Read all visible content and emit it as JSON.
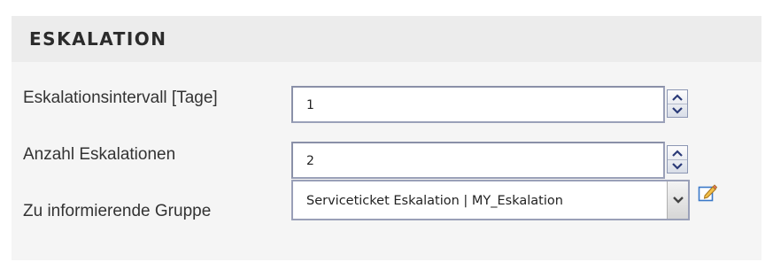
{
  "section": {
    "title": "ESKALATION"
  },
  "fields": [
    {
      "label": "Eskalationsintervall [Tage]",
      "value": "1"
    },
    {
      "label": "Anzahl Eskalationen",
      "value": "2"
    }
  ],
  "group_select": {
    "label": "Zu informierende Gruppe",
    "selected": "Serviceticket Eskalation | MY_Eskalation"
  },
  "icons": {
    "spinner_up": "chevron-up-icon",
    "spinner_down": "chevron-down-icon",
    "select_dropdown": "chevron-down-icon",
    "edit": "pencil-edit-icon"
  },
  "colors": {
    "panel_background": "#f5f5f5",
    "header_background": "#ececec",
    "field_border": "#9aa0b8",
    "spinner_arrow": "#2a3a78",
    "edit_icon": "#3a78c8"
  }
}
